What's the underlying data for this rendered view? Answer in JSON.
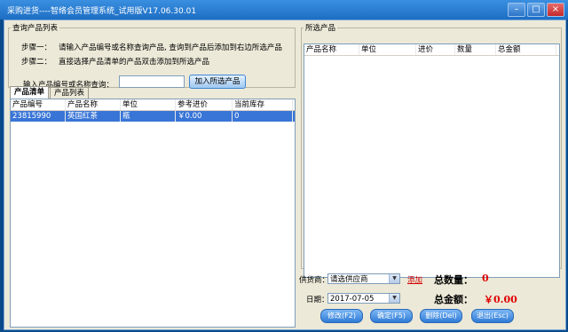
{
  "window": {
    "title": "采购进货----智络会员管理系统_试用版V17.06.30.01"
  },
  "query": {
    "legend": "查询产品列表",
    "step1_label": "步骤一：",
    "step1_text": "请输入产品编号或名称查询产品, 查询到产品后添加到右边所选产品",
    "step2_label": "步骤二：",
    "step2_text": "直接选择产品清单的产品双击添加到所选产品",
    "search_label": "输入产品编号或名称查询：",
    "search_value": "",
    "add_button": "加入所选产品"
  },
  "tabs": [
    {
      "label": "产品清单",
      "active": true
    },
    {
      "label": "产品列表",
      "active": false
    }
  ],
  "product_grid": {
    "columns": [
      "产品编号",
      "产品名称",
      "单位",
      "参考进价",
      "当前库存"
    ],
    "rows": [
      [
        "23815990",
        "英国红茶",
        "瓶",
        "￥0.00",
        "0"
      ]
    ]
  },
  "selected": {
    "legend": "所选产品",
    "columns": [
      "产品名称",
      "单位",
      "进价",
      "数量",
      "总金额"
    ]
  },
  "footer": {
    "supplier_label": "供货商：",
    "supplier_value": "请选供应商",
    "add_link": "添加",
    "date_label": "日期：",
    "date_value": "2017-07-05",
    "total_qty_label": "总数量：",
    "total_qty_value": "0",
    "total_amount_label": "总金额：",
    "total_amount_value": "￥0.00"
  },
  "actions": {
    "modify": "修改(F2)",
    "confirm": "确定(F5)",
    "delete": "删除(Del)",
    "exit": "退出(Esc)"
  },
  "colors": {
    "selection": "#3875d7",
    "accent_red": "#e00000",
    "title_blue": "#1d6ec4"
  }
}
